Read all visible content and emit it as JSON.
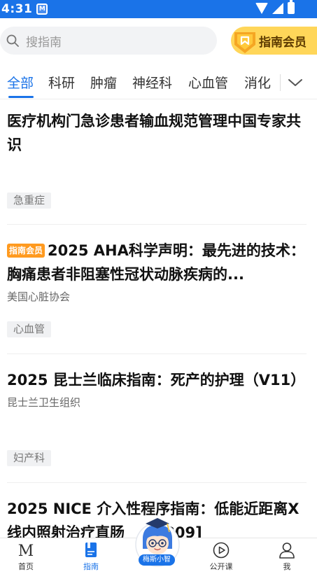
{
  "status_bar": {
    "time": "4:31",
    "app_icon": "app-notification-icon"
  },
  "search": {
    "placeholder": "搜指南",
    "icon": "search-icon"
  },
  "vip_button": {
    "label": "指南会员",
    "icon": "vip-diamond-icon",
    "color": "#ffd659"
  },
  "tabs": [
    {
      "label": "全部",
      "active": true
    },
    {
      "label": "科研"
    },
    {
      "label": "肿瘤"
    },
    {
      "label": "神经科"
    },
    {
      "label": "心血管"
    },
    {
      "label": "消化"
    }
  ],
  "accent_color": "#1a73e8",
  "articles": [
    {
      "title": "医疗机构门急诊患者输血规范管理中国专家共识",
      "org": "",
      "tag": "急重症"
    },
    {
      "badge": "指南会员",
      "title": "2025 AHA科学声明：最先进的技术：胸痛患者非阻塞性冠状动脉疾病的...",
      "org": "美国心脏协会",
      "tag": "心血管"
    },
    {
      "title": "2025 昆士兰临床指南：死产的护理（V11）",
      "org": "昆士兰卫生组织",
      "tag": "妇产科"
    },
    {
      "title": "2025 NICE 介入性程序指南：低能近距离X线内照射治疗直肠",
      "title_tail": "G809]",
      "org": "",
      "tag": ""
    }
  ],
  "bottom_nav": [
    {
      "label": "首页",
      "icon": "home-m-icon"
    },
    {
      "label": "指南",
      "icon": "guide-book-icon",
      "active": true
    },
    {
      "label": "梅斯小智",
      "icon": "mascot-icon"
    },
    {
      "label": "公开课",
      "icon": "play-circle-icon"
    },
    {
      "label": "我",
      "icon": "user-icon"
    }
  ]
}
